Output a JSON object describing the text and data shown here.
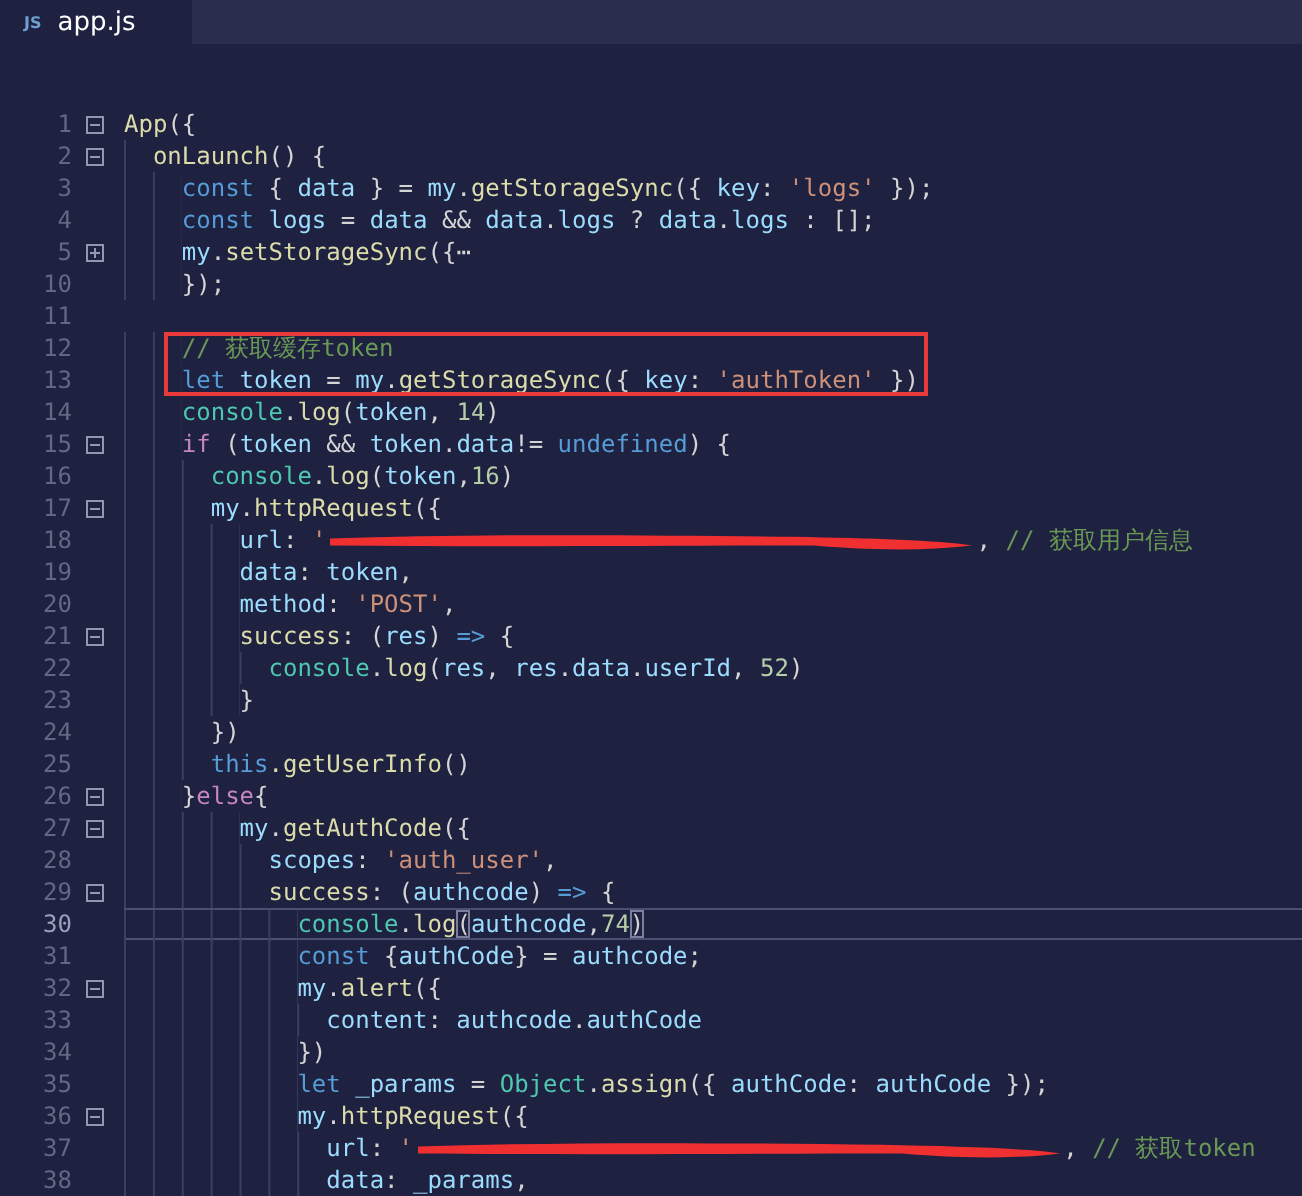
{
  "tabs": [
    {
      "label": "app.js",
      "badge": "JS",
      "selected": true
    }
  ],
  "lines": [
    {
      "kind": "line",
      "number": "1",
      "fold": {
        "expanded": true
      },
      "current": false,
      "segments": [
        {
          "kind": "function",
          "text": "App"
        },
        {
          "kind": "plain",
          "text": "({"
        }
      ]
    },
    {
      "kind": "line",
      "number": "2",
      "fold": {
        "expanded": true
      },
      "current": false,
      "segments": [
        {
          "kind": "function",
          "text": "  onLaunch"
        },
        {
          "kind": "plain",
          "text": "() {"
        }
      ]
    },
    {
      "kind": "line",
      "number": "3",
      "current": false,
      "segments": [
        {
          "kind": "keyword",
          "text": "    const"
        },
        {
          "kind": "plain",
          "text": " { "
        },
        {
          "kind": "variable",
          "text": "data"
        },
        {
          "kind": "plain",
          "text": " } = "
        },
        {
          "kind": "variable",
          "text": "my"
        },
        {
          "kind": "plain",
          "text": "."
        },
        {
          "kind": "function",
          "text": "getStorageSync"
        },
        {
          "kind": "plain",
          "text": "({ "
        },
        {
          "kind": "variable",
          "text": "key"
        },
        {
          "kind": "plain",
          "text": ": "
        },
        {
          "kind": "string",
          "text": "'logs'"
        },
        {
          "kind": "plain",
          "text": " });"
        }
      ]
    },
    {
      "kind": "line",
      "number": "4",
      "current": false,
      "segments": [
        {
          "kind": "keyword",
          "text": "    const"
        },
        {
          "kind": "variable",
          "text": " logs"
        },
        {
          "kind": "plain",
          "text": " = "
        },
        {
          "kind": "variable",
          "text": "data"
        },
        {
          "kind": "plain",
          "text": " && "
        },
        {
          "kind": "variable",
          "text": "data"
        },
        {
          "kind": "plain",
          "text": "."
        },
        {
          "kind": "variable",
          "text": "logs"
        },
        {
          "kind": "plain",
          "text": " ? "
        },
        {
          "kind": "variable",
          "text": "data"
        },
        {
          "kind": "plain",
          "text": "."
        },
        {
          "kind": "variable",
          "text": "logs"
        },
        {
          "kind": "plain",
          "text": " : [];"
        }
      ]
    },
    {
      "kind": "line",
      "number": "5",
      "fold": {
        "expanded": false
      },
      "current": false,
      "segments": [
        {
          "kind": "variable",
          "text": "    my"
        },
        {
          "kind": "plain",
          "text": "."
        },
        {
          "kind": "function",
          "text": "setStorageSync"
        },
        {
          "kind": "plain",
          "text": "({⋯"
        }
      ]
    },
    {
      "kind": "line",
      "number": "10",
      "current": false,
      "segments": [
        {
          "kind": "plain",
          "text": "    });"
        }
      ]
    },
    {
      "kind": "line",
      "number": "11",
      "current": false
    },
    {
      "kind": "boxed_group",
      "lines": [
        {
          "kind": "line",
          "number": "12",
          "current": false,
          "segments": [
            {
              "kind": "comment",
              "text": "    // 获取缓存token"
            }
          ]
        },
        {
          "kind": "line",
          "number": "13",
          "current": false,
          "segments": [
            {
              "kind": "keyword",
              "text": "    let"
            },
            {
              "kind": "variable",
              "text": " token"
            },
            {
              "kind": "plain",
              "text": " = "
            },
            {
              "kind": "variable",
              "text": "my"
            },
            {
              "kind": "plain",
              "text": "."
            },
            {
              "kind": "function",
              "text": "getStorageSync"
            },
            {
              "kind": "plain",
              "text": "({ "
            },
            {
              "kind": "variable",
              "text": "key"
            },
            {
              "kind": "plain",
              "text": ": "
            },
            {
              "kind": "string",
              "text": "'authToken'"
            },
            {
              "kind": "plain",
              "text": " })"
            }
          ]
        }
      ]
    },
    {
      "kind": "line",
      "number": "14",
      "current": false,
      "segments": [
        {
          "kind": "type",
          "text": "    console"
        },
        {
          "kind": "plain",
          "text": "."
        },
        {
          "kind": "function",
          "text": "log"
        },
        {
          "kind": "plain",
          "text": "("
        },
        {
          "kind": "variable",
          "text": "token"
        },
        {
          "kind": "plain",
          "text": ", "
        },
        {
          "kind": "number",
          "text": "14"
        },
        {
          "kind": "plain",
          "text": ")"
        }
      ]
    },
    {
      "kind": "line",
      "number": "15",
      "fold": {
        "expanded": true
      },
      "current": false,
      "segments": [
        {
          "kind": "control",
          "text": "    if"
        },
        {
          "kind": "plain",
          "text": " ("
        },
        {
          "kind": "variable",
          "text": "token"
        },
        {
          "kind": "plain",
          "text": " && "
        },
        {
          "kind": "variable",
          "text": "token"
        },
        {
          "kind": "plain",
          "text": "."
        },
        {
          "kind": "variable",
          "text": "data"
        },
        {
          "kind": "plain",
          "text": "!= "
        },
        {
          "kind": "keyword",
          "text": "undefined"
        },
        {
          "kind": "plain",
          "text": ") {"
        }
      ]
    },
    {
      "kind": "line",
      "number": "16",
      "current": false,
      "segments": [
        {
          "kind": "type",
          "text": "      console"
        },
        {
          "kind": "plain",
          "text": "."
        },
        {
          "kind": "function",
          "text": "log"
        },
        {
          "kind": "plain",
          "text": "("
        },
        {
          "kind": "variable",
          "text": "token"
        },
        {
          "kind": "plain",
          "text": ","
        },
        {
          "kind": "number",
          "text": "16"
        },
        {
          "kind": "plain",
          "text": ")"
        }
      ]
    },
    {
      "kind": "line",
      "number": "17",
      "fold": {
        "expanded": true
      },
      "current": false,
      "segments": [
        {
          "kind": "variable",
          "text": "      my"
        },
        {
          "kind": "plain",
          "text": "."
        },
        {
          "kind": "function",
          "text": "httpRequest"
        },
        {
          "kind": "plain",
          "text": "({"
        }
      ]
    },
    {
      "kind": "line",
      "number": "18",
      "current": false,
      "segments": [
        {
          "kind": "variable",
          "text": "        url"
        },
        {
          "kind": "plain",
          "text": ": "
        },
        {
          "kind": "string",
          "text": "'"
        },
        {
          "kind": "redaction"
        },
        {
          "kind": "plain",
          "text": ", "
        },
        {
          "kind": "comment",
          "text": "// 获取用户信息"
        }
      ]
    },
    {
      "kind": "line",
      "number": "19",
      "current": false,
      "segments": [
        {
          "kind": "variable",
          "text": "        data"
        },
        {
          "kind": "plain",
          "text": ": "
        },
        {
          "kind": "variable",
          "text": "token"
        },
        {
          "kind": "plain",
          "text": ","
        }
      ]
    },
    {
      "kind": "line",
      "number": "20",
      "current": false,
      "segments": [
        {
          "kind": "variable",
          "text": "        method"
        },
        {
          "kind": "plain",
          "text": ": "
        },
        {
          "kind": "string",
          "text": "'POST'"
        },
        {
          "kind": "plain",
          "text": ","
        }
      ]
    },
    {
      "kind": "line",
      "number": "21",
      "fold": {
        "expanded": true
      },
      "current": false,
      "segments": [
        {
          "kind": "function",
          "text": "        success"
        },
        {
          "kind": "plain",
          "text": ": ("
        },
        {
          "kind": "variable",
          "text": "res"
        },
        {
          "kind": "plain",
          "text": ") "
        },
        {
          "kind": "keyword",
          "text": "=>"
        },
        {
          "kind": "plain",
          "text": " {"
        }
      ]
    },
    {
      "kind": "line",
      "number": "22",
      "current": false,
      "segments": [
        {
          "kind": "type",
          "text": "          console"
        },
        {
          "kind": "plain",
          "text": "."
        },
        {
          "kind": "function",
          "text": "log"
        },
        {
          "kind": "plain",
          "text": "("
        },
        {
          "kind": "variable",
          "text": "res"
        },
        {
          "kind": "plain",
          "text": ", "
        },
        {
          "kind": "variable",
          "text": "res"
        },
        {
          "kind": "plain",
          "text": "."
        },
        {
          "kind": "variable",
          "text": "data"
        },
        {
          "kind": "plain",
          "text": "."
        },
        {
          "kind": "variable",
          "text": "userId"
        },
        {
          "kind": "plain",
          "text": ", "
        },
        {
          "kind": "number",
          "text": "52"
        },
        {
          "kind": "plain",
          "text": ")"
        }
      ]
    },
    {
      "kind": "line",
      "number": "23",
      "current": false,
      "segments": [
        {
          "kind": "plain",
          "text": "        }"
        }
      ]
    },
    {
      "kind": "line",
      "number": "24",
      "current": false,
      "segments": [
        {
          "kind": "plain",
          "text": "      })"
        }
      ]
    },
    {
      "kind": "line",
      "number": "25",
      "current": false,
      "segments": [
        {
          "kind": "keyword",
          "text": "      this"
        },
        {
          "kind": "function",
          "text": ".getUserInfo"
        },
        {
          "kind": "plain",
          "text": "()"
        }
      ]
    },
    {
      "kind": "line",
      "number": "26",
      "fold": {
        "expanded": true
      },
      "current": false,
      "segments": [
        {
          "kind": "plain",
          "text": "    }"
        },
        {
          "kind": "control",
          "text": "else"
        },
        {
          "kind": "plain",
          "text": "{"
        }
      ]
    },
    {
      "kind": "line",
      "number": "27",
      "fold": {
        "expanded": true
      },
      "current": false,
      "segments": [
        {
          "kind": "variable",
          "text": "        my"
        },
        {
          "kind": "plain",
          "text": "."
        },
        {
          "kind": "function",
          "text": "getAuthCode"
        },
        {
          "kind": "plain",
          "text": "({"
        }
      ]
    },
    {
      "kind": "line",
      "number": "28",
      "current": false,
      "segments": [
        {
          "kind": "variable",
          "text": "          scopes"
        },
        {
          "kind": "plain",
          "text": ": "
        },
        {
          "kind": "string",
          "text": "'auth_user'"
        },
        {
          "kind": "plain",
          "text": ","
        }
      ]
    },
    {
      "kind": "line",
      "number": "29",
      "fold": {
        "expanded": true
      },
      "current": false,
      "segments": [
        {
          "kind": "function",
          "text": "          success"
        },
        {
          "kind": "plain",
          "text": ": ("
        },
        {
          "kind": "variable",
          "text": "authcode"
        },
        {
          "kind": "plain",
          "text": ") "
        },
        {
          "kind": "keyword",
          "text": "=>"
        },
        {
          "kind": "plain",
          "text": " {"
        }
      ]
    },
    {
      "kind": "line",
      "number": "30",
      "current": true,
      "segments": [
        {
          "kind": "type",
          "text": "            console"
        },
        {
          "kind": "plain",
          "text": "."
        },
        {
          "kind": "function",
          "text": "log"
        },
        {
          "kind": "bracket",
          "text": "("
        },
        {
          "kind": "variable",
          "text": "authcode"
        },
        {
          "kind": "plain",
          "text": ","
        },
        {
          "kind": "number",
          "text": "74"
        },
        {
          "kind": "bracket",
          "text": ")"
        }
      ]
    },
    {
      "kind": "line",
      "number": "31",
      "current": false,
      "segments": [
        {
          "kind": "keyword",
          "text": "            const"
        },
        {
          "kind": "plain",
          "text": " {"
        },
        {
          "kind": "variable",
          "text": "authCode"
        },
        {
          "kind": "plain",
          "text": "} = "
        },
        {
          "kind": "variable",
          "text": "authcode"
        },
        {
          "kind": "plain",
          "text": ";"
        }
      ]
    },
    {
      "kind": "line",
      "number": "32",
      "fold": {
        "expanded": true
      },
      "current": false,
      "segments": [
        {
          "kind": "variable",
          "text": "            my"
        },
        {
          "kind": "plain",
          "text": "."
        },
        {
          "kind": "function",
          "text": "alert"
        },
        {
          "kind": "plain",
          "text": "({"
        }
      ]
    },
    {
      "kind": "line",
      "number": "33",
      "current": false,
      "segments": [
        {
          "kind": "variable",
          "text": "              content"
        },
        {
          "kind": "plain",
          "text": ": "
        },
        {
          "kind": "variable",
          "text": "authcode"
        },
        {
          "kind": "plain",
          "text": "."
        },
        {
          "kind": "variable",
          "text": "authCode"
        }
      ]
    },
    {
      "kind": "line",
      "number": "34",
      "current": false,
      "segments": [
        {
          "kind": "plain",
          "text": "            })"
        }
      ]
    },
    {
      "kind": "line",
      "number": "35",
      "current": false,
      "segments": [
        {
          "kind": "keyword",
          "text": "            let"
        },
        {
          "kind": "variable",
          "text": " _params"
        },
        {
          "kind": "plain",
          "text": " = "
        },
        {
          "kind": "type",
          "text": "Object"
        },
        {
          "kind": "plain",
          "text": "."
        },
        {
          "kind": "function",
          "text": "assign"
        },
        {
          "kind": "plain",
          "text": "({ "
        },
        {
          "kind": "variable",
          "text": "authCode"
        },
        {
          "kind": "plain",
          "text": ": "
        },
        {
          "kind": "variable",
          "text": "authCode"
        },
        {
          "kind": "plain",
          "text": " });"
        }
      ]
    },
    {
      "kind": "line",
      "number": "36",
      "fold": {
        "expanded": true
      },
      "current": false,
      "segments": [
        {
          "kind": "variable",
          "text": "            my"
        },
        {
          "kind": "plain",
          "text": "."
        },
        {
          "kind": "function",
          "text": "httpRequest"
        },
        {
          "kind": "plain",
          "text": "({"
        }
      ]
    },
    {
      "kind": "line",
      "number": "37",
      "current": false,
      "segments": [
        {
          "kind": "variable",
          "text": "              url"
        },
        {
          "kind": "plain",
          "text": ": "
        },
        {
          "kind": "string",
          "text": "'"
        },
        {
          "kind": "redaction"
        },
        {
          "kind": "plain",
          "text": ", "
        },
        {
          "kind": "comment",
          "text": "// 获取token"
        }
      ]
    },
    {
      "kind": "line",
      "number": "38",
      "current": false,
      "segments": [
        {
          "kind": "variable",
          "text": "              data"
        },
        {
          "kind": "plain",
          "text": ": "
        },
        {
          "kind": "variable",
          "text": "_params"
        },
        {
          "kind": "plain",
          "text": ","
        }
      ]
    }
  ]
}
